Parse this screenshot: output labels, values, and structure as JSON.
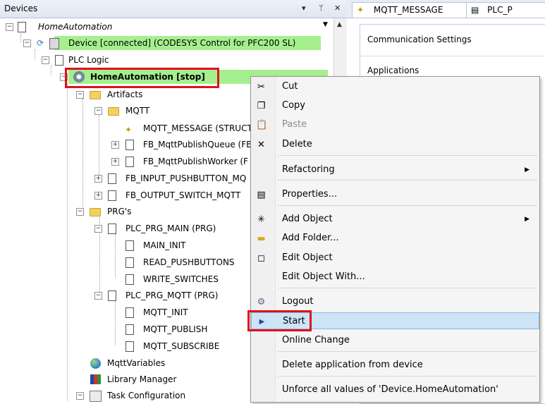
{
  "devices_panel": {
    "title": "Devices",
    "title_buttons": [
      "▾",
      "ᛘ",
      "✕"
    ]
  },
  "tree": {
    "root": "HomeAutomation",
    "device": "Device [connected] (CODESYS Control for PFC200 SL)",
    "plc_logic": "PLC Logic",
    "application": "HomeAutomation [stop]",
    "artifacts": "Artifacts",
    "mqtt_folder": "MQTT",
    "mqtt_message": "MQTT_MESSAGE (STRUCT",
    "fb_mqttpublishqueue": "FB_MqttPublishQueue (FB",
    "fb_mqttpublishworker": "FB_MqttPublishWorker (F",
    "fb_input_pushbutton": "FB_INPUT_PUSHBUTTON_MQ",
    "fb_output_switch": "FB_OUTPUT_SWITCH_MQTT",
    "prgs": "PRG's",
    "plc_prg_main": "PLC_PRG_MAIN (PRG)",
    "main_init": "MAIN_INIT",
    "read_pushbuttons": "READ_PUSHBUTTONS",
    "write_switches": "WRITE_SWITCHES",
    "plc_prg_mqtt": "PLC_PRG_MQTT (PRG)",
    "mqtt_init": "MQTT_INIT",
    "mqtt_publish": "MQTT_PUBLISH",
    "mqtt_subscribe": "MQTT_SUBSCRIBE",
    "mqtt_variables": "MqttVariables",
    "library_manager": "Library Manager",
    "task_configuration": "Task Configuration"
  },
  "tabs": {
    "tab1": "MQTT_MESSAGE",
    "tab2": "PLC_P"
  },
  "settings": {
    "communication": "Communication Settings",
    "applications": "Applications"
  },
  "context_menu": {
    "cut": "Cut",
    "copy": "Copy",
    "paste": "Paste",
    "delete": "Delete",
    "refactoring": "Refactoring",
    "properties": "Properties...",
    "add_object": "Add Object",
    "add_folder": "Add Folder...",
    "edit_object": "Edit Object",
    "edit_object_with": "Edit Object With...",
    "logout": "Logout",
    "start": "Start",
    "online_change": "Online Change",
    "delete_application": "Delete application from device",
    "unforce": "Unforce all values of 'Device.HomeAutomation'"
  },
  "colors": {
    "connected_highlight": "#a6ef8e",
    "annotation_red": "#e0101c",
    "menu_highlight": "#cde4f7"
  }
}
